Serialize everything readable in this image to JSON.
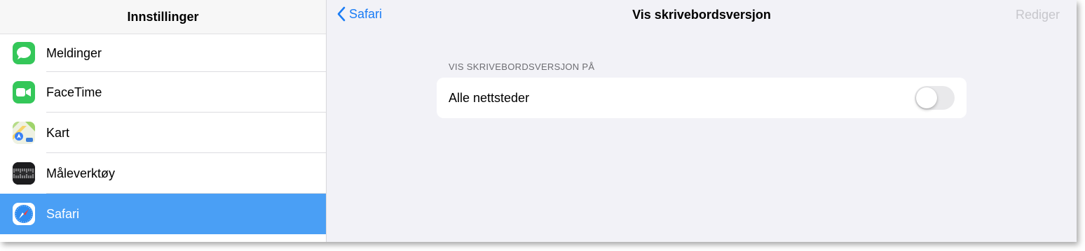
{
  "sidebar": {
    "title": "Innstillinger",
    "items": [
      {
        "label": "Meldinger",
        "icon": "messages-icon"
      },
      {
        "label": "FaceTime",
        "icon": "facetime-icon"
      },
      {
        "label": "Kart",
        "icon": "maps-icon"
      },
      {
        "label": "Måleverktøy",
        "icon": "measure-icon"
      },
      {
        "label": "Safari",
        "icon": "safari-icon",
        "selected": true
      }
    ]
  },
  "navbar": {
    "back_label": "Safari",
    "title": "Vis skrivebordsversjon",
    "edit_label": "Rediger"
  },
  "section": {
    "header": "VIS SKRIVEBORDSVERSJON PÅ",
    "rows": [
      {
        "label": "Alle nettsteder",
        "toggle_on": false
      }
    ]
  },
  "colors": {
    "accent": "#1a7cf5",
    "selected_row": "#4a9ff5",
    "messages_green": "#34c759",
    "disabled_text": "#c7c7cc"
  }
}
